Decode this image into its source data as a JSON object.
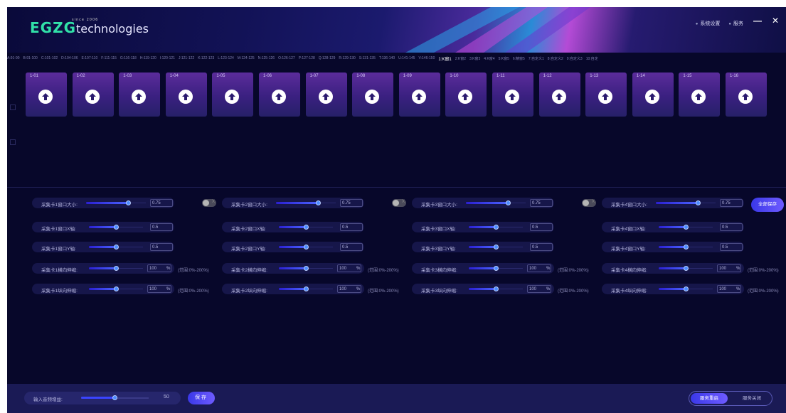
{
  "header": {
    "logo_main": "EGZG",
    "logo_sub": "technologies",
    "logo_since": "since 2006",
    "nav": [
      "系统设置",
      "服务"
    ],
    "minimize": "—",
    "close": "✕"
  },
  "tabs": [
    "A:91-90",
    "B:91-100",
    "C:101-102",
    "D:104-106",
    "E:107-110",
    "F:111-115",
    "G:116-118",
    "H:119-120",
    "I:120-121",
    "J:121-122",
    "K:122-123",
    "L:123-124",
    "M:124-125",
    "N:125-126",
    "O:126-127",
    "P:127-128",
    "Q:128-129",
    "R:129-130",
    "S:131-135",
    "T:136-140",
    "U:141-145",
    "V:146-150",
    "1:K窗1",
    "2:K窗2",
    "3:K窗3",
    "4:K窗4",
    "5:K窗5",
    "6:精窗5",
    "7:自定义1",
    "8:自定义2",
    "9:自定义3",
    "10:自定"
  ],
  "active_tab": "1:K窗1",
  "cards": [
    "1-01",
    "1-02",
    "1-03",
    "1-04",
    "1-05",
    "1-06",
    "1-07",
    "1-08",
    "1-09",
    "1-10",
    "1-11",
    "1-12",
    "1-13",
    "1-14",
    "1-15",
    "1-16"
  ],
  "capture_cards": [
    {
      "rows": [
        {
          "label": "采集卡1窗口大小:",
          "value": "0.75",
          "level": 0.7
        },
        {
          "label": "采集卡1窗口X轴:",
          "value": "0.5",
          "level": 0.5
        },
        {
          "label": "采集卡1窗口Y轴:",
          "value": "0.5",
          "level": 0.5
        },
        {
          "label": "采集卡1横向伸缩:",
          "value": "100",
          "unit": "%",
          "range": "(范围:0%-200%)",
          "level": 0.5
        },
        {
          "label": "采集卡1纵向伸缩:",
          "value": "100",
          "unit": "%",
          "range": "(范围:0%-200%)",
          "level": 0.5
        }
      ]
    },
    {
      "rows": [
        {
          "label": "采集卡2窗口大小:",
          "value": "0.75",
          "level": 0.7
        },
        {
          "label": "采集卡2窗口X轴:",
          "value": "0.5",
          "level": 0.5
        },
        {
          "label": "采集卡2窗口Y轴:",
          "value": "0.5",
          "level": 0.5
        },
        {
          "label": "采集卡2横向伸缩:",
          "value": "100",
          "unit": "%",
          "range": "(范围:0%-200%)",
          "level": 0.5
        },
        {
          "label": "采集卡2纵向伸缩:",
          "value": "100",
          "unit": "%",
          "range": "(范围:0%-200%)",
          "level": 0.5
        }
      ]
    },
    {
      "rows": [
        {
          "label": "采集卡3窗口大小:",
          "value": "0.75",
          "level": 0.7
        },
        {
          "label": "采集卡3窗口X轴:",
          "value": "0.5",
          "level": 0.5
        },
        {
          "label": "采集卡3窗口Y轴:",
          "value": "0.5",
          "level": 0.5
        },
        {
          "label": "采集卡3横向伸缩:",
          "value": "100",
          "unit": "%",
          "range": "(范围:0%-200%)",
          "level": 0.5
        },
        {
          "label": "采集卡3纵向伸缩:",
          "value": "100",
          "unit": "%",
          "range": "(范围:0%-200%)",
          "level": 0.5
        }
      ]
    },
    {
      "rows": [
        {
          "label": "采集卡4窗口大小:",
          "value": "0.75",
          "level": 0.7
        },
        {
          "label": "采集卡4窗口X轴:",
          "value": "0.5",
          "level": 0.5
        },
        {
          "label": "采集卡4窗口Y轴:",
          "value": "0.5",
          "level": 0.5
        },
        {
          "label": "采集卡4横向伸缩:",
          "value": "100",
          "unit": "%",
          "range": "(范围:0%-200%)",
          "level": 0.5
        },
        {
          "label": "采集卡4纵向伸缩:",
          "value": "100",
          "unit": "%",
          "range": "(范围:0%-200%)",
          "level": 0.5
        }
      ]
    }
  ],
  "toggle_x": "X",
  "save_all": "全部保存",
  "footer": {
    "gain_label": "输入音频增益:",
    "gain_value": "50",
    "gain_level": 0.5,
    "save": "保存",
    "service_restart": "服务重启",
    "service_close": "服务关闭"
  },
  "colors": {
    "background": "#07072a",
    "card": "#3a2080",
    "accent": "#3a38e8",
    "logo": "#31e0a8"
  }
}
